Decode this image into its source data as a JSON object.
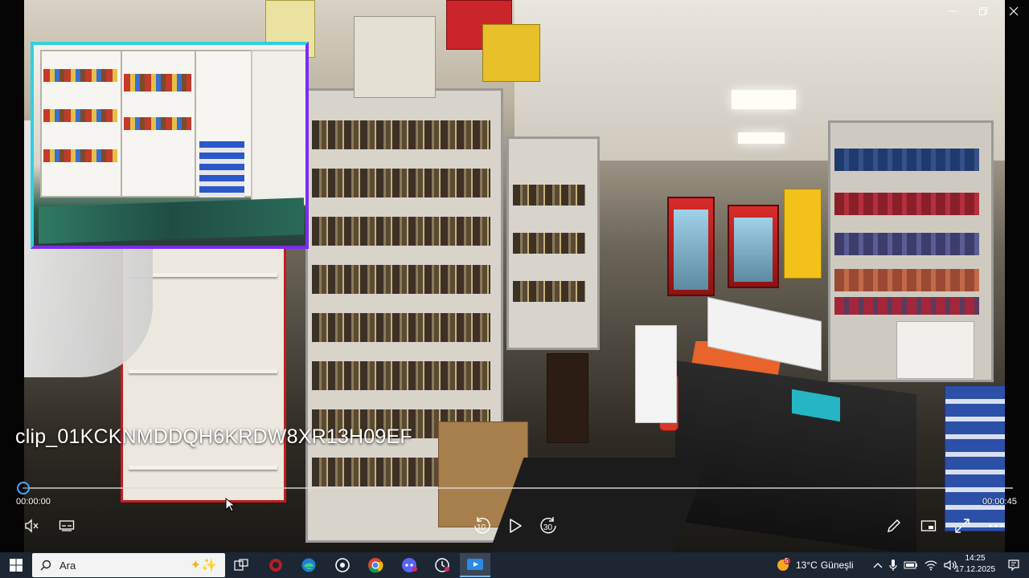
{
  "window": {
    "controls": {
      "minimize_icon": "minimize-icon",
      "maximize_icon": "maximize-icon",
      "close_icon": "close-icon"
    }
  },
  "video": {
    "clip_title": "clip_01KCKNMDDQH6KRDW8XR13H09EF",
    "scene": "store interior with cigarette shelves and picture-in-picture overlay"
  },
  "player": {
    "current_time": "00:00:00",
    "total_time": "00:00:45",
    "progress": 0,
    "skip_back_seconds": "10",
    "skip_forward_seconds": "30",
    "accent_color": "#4ea6ff",
    "left_controls": [
      "volume-mute-icon",
      "subtitles-icon"
    ],
    "center_controls": [
      "skip-back-10-icon",
      "play-icon",
      "skip-forward-30-icon"
    ],
    "right_controls": [
      "edit-pencil-icon",
      "miniplayer-icon",
      "fullscreen-icon",
      "more-options-icon"
    ]
  },
  "taskbar": {
    "search_placeholder": "Ara",
    "pinned": [
      "start-icon",
      "task-view-icon",
      "app-red-icon",
      "edge-icon",
      "app-circle-icon",
      "chrome-icon",
      "discord-icon",
      "app-clock-icon",
      "media-player-icon"
    ],
    "weather": {
      "temp": "13°C",
      "condition": "Güneşli",
      "badge": "5"
    },
    "clock_time": "14:25",
    "clock_date": "17.12.2025"
  }
}
